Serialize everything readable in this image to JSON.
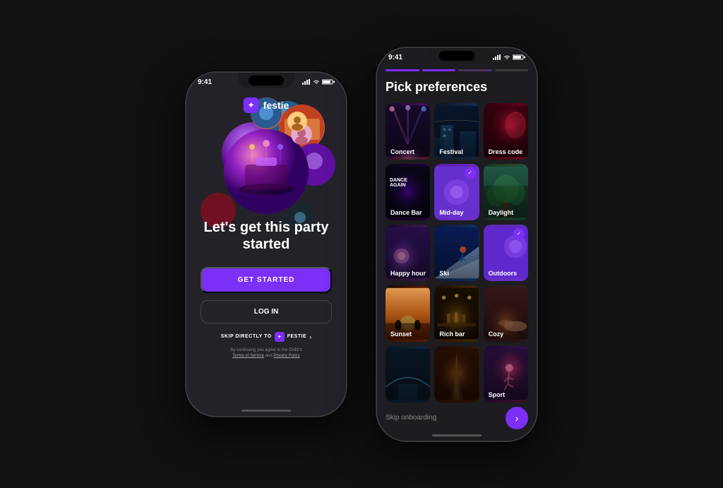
{
  "app": {
    "name": "festie",
    "status_time": "9:41"
  },
  "left_phone": {
    "title": "Let's get this party started",
    "get_started_btn": "GET STARTED",
    "login_btn": "LOG IN",
    "skip_label": "SKIP DIRECTLY TO",
    "skip_app_name": "FESTIE",
    "legal_text": "By continuing you agree to the Chillz's",
    "terms_link": "Terms of Service",
    "and_text": "and",
    "privacy_link": "Privacy Policy"
  },
  "right_phone": {
    "title": "Pick preferences",
    "progress": [
      {
        "state": "active"
      },
      {
        "state": "active"
      },
      {
        "state": "partial"
      },
      {
        "state": "inactive"
      }
    ],
    "categories": [
      {
        "id": "concert",
        "label": "Concert",
        "selected": false,
        "bg": "concert"
      },
      {
        "id": "festival",
        "label": "Festival",
        "selected": false,
        "bg": "festival"
      },
      {
        "id": "dresscode",
        "label": "Dress code",
        "selected": false,
        "bg": "dresscode"
      },
      {
        "id": "dancebar",
        "label": "Dance Bar",
        "selected": false,
        "bg": "dancebar"
      },
      {
        "id": "midday",
        "label": "Mid-day",
        "selected": true,
        "bg": "midday"
      },
      {
        "id": "daylight",
        "label": "Daylight",
        "selected": false,
        "bg": "daylight"
      },
      {
        "id": "happyhour",
        "label": "Happy hour",
        "selected": false,
        "bg": "happyhour"
      },
      {
        "id": "ski",
        "label": "Ski",
        "selected": false,
        "bg": "ski"
      },
      {
        "id": "outdoors",
        "label": "Outdoors",
        "selected": true,
        "bg": "outdoors"
      },
      {
        "id": "sunset",
        "label": "Sunset",
        "selected": false,
        "bg": "sunset"
      },
      {
        "id": "richbar",
        "label": "Rich bar",
        "selected": false,
        "bg": "richbar"
      },
      {
        "id": "cozy",
        "label": "Cozy",
        "selected": false,
        "bg": "cozy"
      },
      {
        "id": "bottom1",
        "label": "",
        "selected": false,
        "bg": "bottom1"
      },
      {
        "id": "bottom2",
        "label": "",
        "selected": false,
        "bg": "bottom2"
      },
      {
        "id": "sport",
        "label": "Sport",
        "selected": false,
        "bg": "sport"
      }
    ],
    "skip_onboarding": "Skip onboarding",
    "next_arrow": "›"
  }
}
